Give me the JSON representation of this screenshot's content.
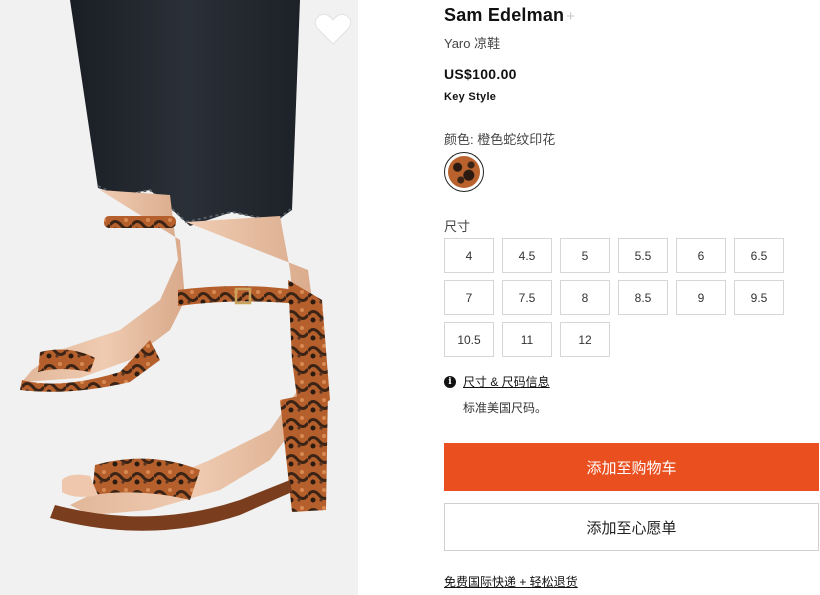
{
  "product": {
    "brand": "Sam Edelman",
    "follow_symbol": "+",
    "name": "Yaro 凉鞋",
    "price": "US$100.00",
    "badge": "Key Style",
    "color_label": "颜色: 橙色蛇纹印花",
    "swatch_color": "#b9622e",
    "favorite_icon": "heart-outline-icon"
  },
  "size": {
    "label": "尺寸",
    "options": [
      "4",
      "4.5",
      "5",
      "5.5",
      "6",
      "6.5",
      "7",
      "7.5",
      "8",
      "8.5",
      "9",
      "9.5",
      "10.5",
      "11",
      "12"
    ],
    "info_icon": "info-icon",
    "info_link": "尺寸 & 尺码信息",
    "standard_note": "标准美国尺码。"
  },
  "actions": {
    "add_to_cart": "添加至购物车",
    "add_to_wishlist": "添加至心愿单",
    "accent_color": "#e94f1f"
  },
  "footer": {
    "shipping_link": "免费国际快递 + 轻松退货"
  }
}
